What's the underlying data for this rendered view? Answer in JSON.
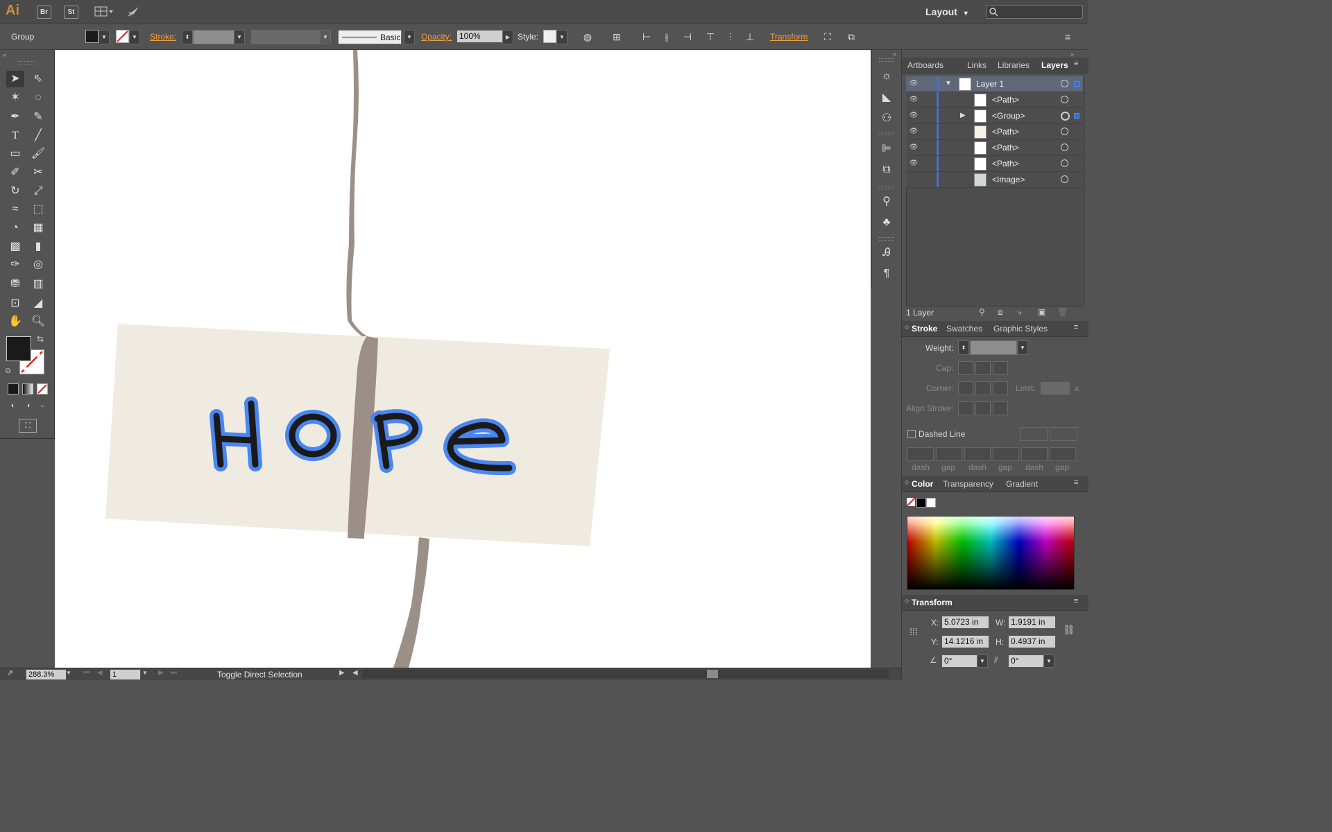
{
  "app": {
    "logo": "Ai",
    "bridge_label": "Br",
    "stock_label": "St",
    "workspace": "Layout",
    "workspace_arrow": "▾"
  },
  "control_bar": {
    "selection_type": "Group",
    "stroke_label": "Stroke:",
    "brush_label": "Basic",
    "opacity_label": "Opacity:",
    "opacity_value": "100%",
    "style_label": "Style:",
    "transform_label": "Transform"
  },
  "artwork": {
    "text": "HOPE",
    "colors": {
      "paper": "#efebe0",
      "string": "#9c8f88",
      "ink": "#1a1a1a",
      "selection": "#4a86f0"
    }
  },
  "layers_panel": {
    "tabs": [
      "Artboards",
      "Links",
      "Libraries",
      "Layers"
    ],
    "active_tab": "Layers",
    "rows": [
      {
        "name": "Layer 1",
        "selected": true
      },
      {
        "name": "<Path>"
      },
      {
        "name": "<Group>"
      },
      {
        "name": "<Path>"
      },
      {
        "name": "<Path>"
      },
      {
        "name": "<Path>"
      },
      {
        "name": "<Image>"
      }
    ],
    "footer": "1 Layer"
  },
  "stroke_panel": {
    "tabs": [
      "Stroke",
      "Swatches",
      "Graphic Styles"
    ],
    "weight_label": "Weight:",
    "cap_label": "Cap:",
    "corner_label": "Corner:",
    "limit_label": "Limit:",
    "limit_x": "x",
    "align_label": "Align Stroke:",
    "dashed_label": "Dashed Line",
    "dash_labels": [
      "dash",
      "gap",
      "dash",
      "gap",
      "dash",
      "gap"
    ]
  },
  "color_panel": {
    "tabs": [
      "Color",
      "Transparency",
      "Gradient"
    ]
  },
  "transform_panel": {
    "title": "Transform",
    "x_label": "X:",
    "x_value": "5.0723 in",
    "y_label": "Y:",
    "y_value": "14.1216 in",
    "w_label": "W:",
    "w_value": "1.9191 in",
    "h_label": "H:",
    "h_value": "0.4937 in",
    "rotate_value": "0°",
    "shear_value": "0°"
  },
  "status_bar": {
    "zoom": "288.3%",
    "artboard": "1",
    "tool_status": "Toggle Direct Selection"
  }
}
